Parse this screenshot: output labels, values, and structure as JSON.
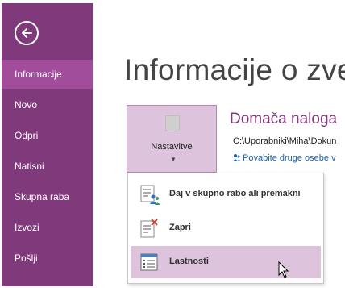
{
  "sidebar": {
    "items": [
      {
        "label": "Informacije",
        "active": true
      },
      {
        "label": "Novo"
      },
      {
        "label": "Odpri"
      },
      {
        "label": "Natisni"
      },
      {
        "label": "Skupna raba"
      },
      {
        "label": "Izvozi"
      },
      {
        "label": "Pošlji"
      }
    ]
  },
  "main": {
    "title": "Informacije o zve",
    "settings_button_label": "Nastavitve",
    "notebook": {
      "title": "Domača naloga",
      "path": "C:\\Uporabniki\\Miha\\Dokun",
      "share_link": "Povabite druge osebe v"
    }
  },
  "menu": {
    "items": [
      {
        "label": "Daj v skupno rabo ali premakni",
        "icon": "share-move-icon"
      },
      {
        "label": "Zapri",
        "icon": "close-notebook-icon"
      },
      {
        "label": "Lastnosti",
        "icon": "properties-icon",
        "hovered": true
      }
    ]
  },
  "colors": {
    "sidebar_bg": "#80397b",
    "sidebar_active": "#a14d9b",
    "accent_text": "#80397b",
    "highlight": "#ddc3db",
    "link": "#1e5fad"
  }
}
